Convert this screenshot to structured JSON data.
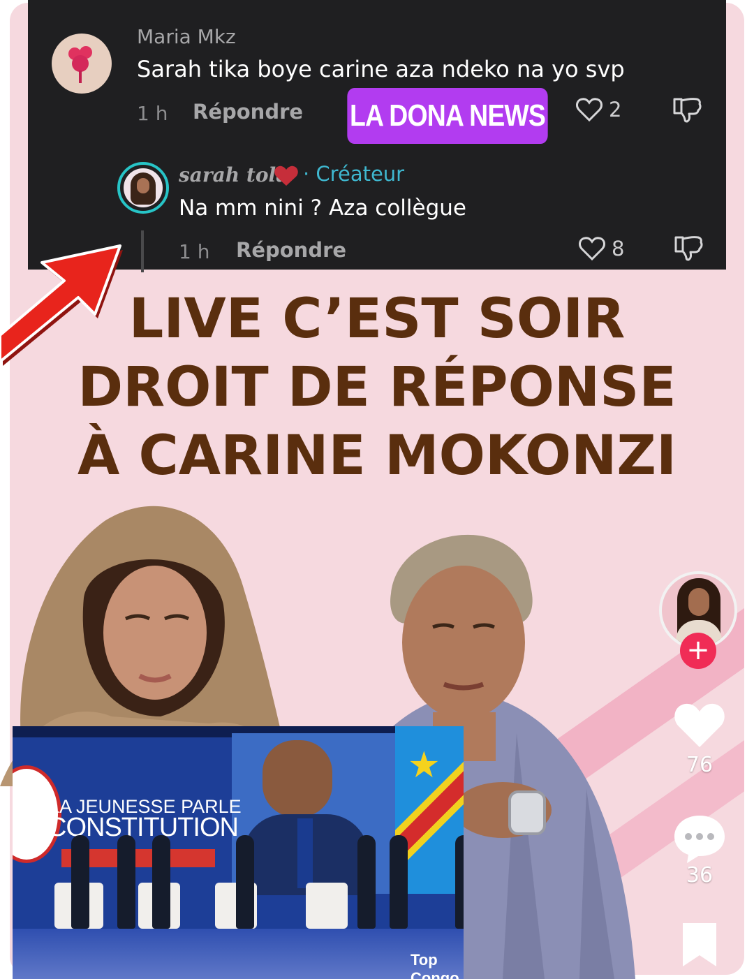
{
  "comments": [
    {
      "author": "Maria Mkz",
      "text": "Sarah tika boye carine aza ndeko na yo svp",
      "time": "1 h",
      "reply_label": "Répondre",
      "likes": "2"
    },
    {
      "author": "sarah tola",
      "creator_label": "· Créateur",
      "text": "Na mm nini ? Aza collègue",
      "time": "1 h",
      "reply_label": "Répondre",
      "likes": "8"
    }
  ],
  "brand_badge": "LA DONA NEWS",
  "headline": {
    "lines": [
      "LIVE C’EST SOIR",
      "DROIT DE RÉPONSE",
      "À CARINE MOKONZI"
    ]
  },
  "inset_photo": {
    "banner_line1": "LA JEUNESSE PARLE",
    "banner_line2": "CONSTITUTION",
    "watermark": "Top Congo"
  },
  "side_actions": {
    "likes": "76",
    "comments": "36"
  },
  "icons": [
    "heart-icon",
    "dislike-icon",
    "red-heart-icon",
    "plus-icon",
    "comment-icon",
    "bookmark-icon",
    "arrow-icon"
  ],
  "colors": {
    "panel_bg": "#1f1f21",
    "brand_badge": "#b23cf0",
    "creator": "#3fb8d0",
    "headline": "#5a2e0e",
    "card_bg": "#f6d9df",
    "follow": "#f02c56",
    "arrow": "#e8241c"
  }
}
